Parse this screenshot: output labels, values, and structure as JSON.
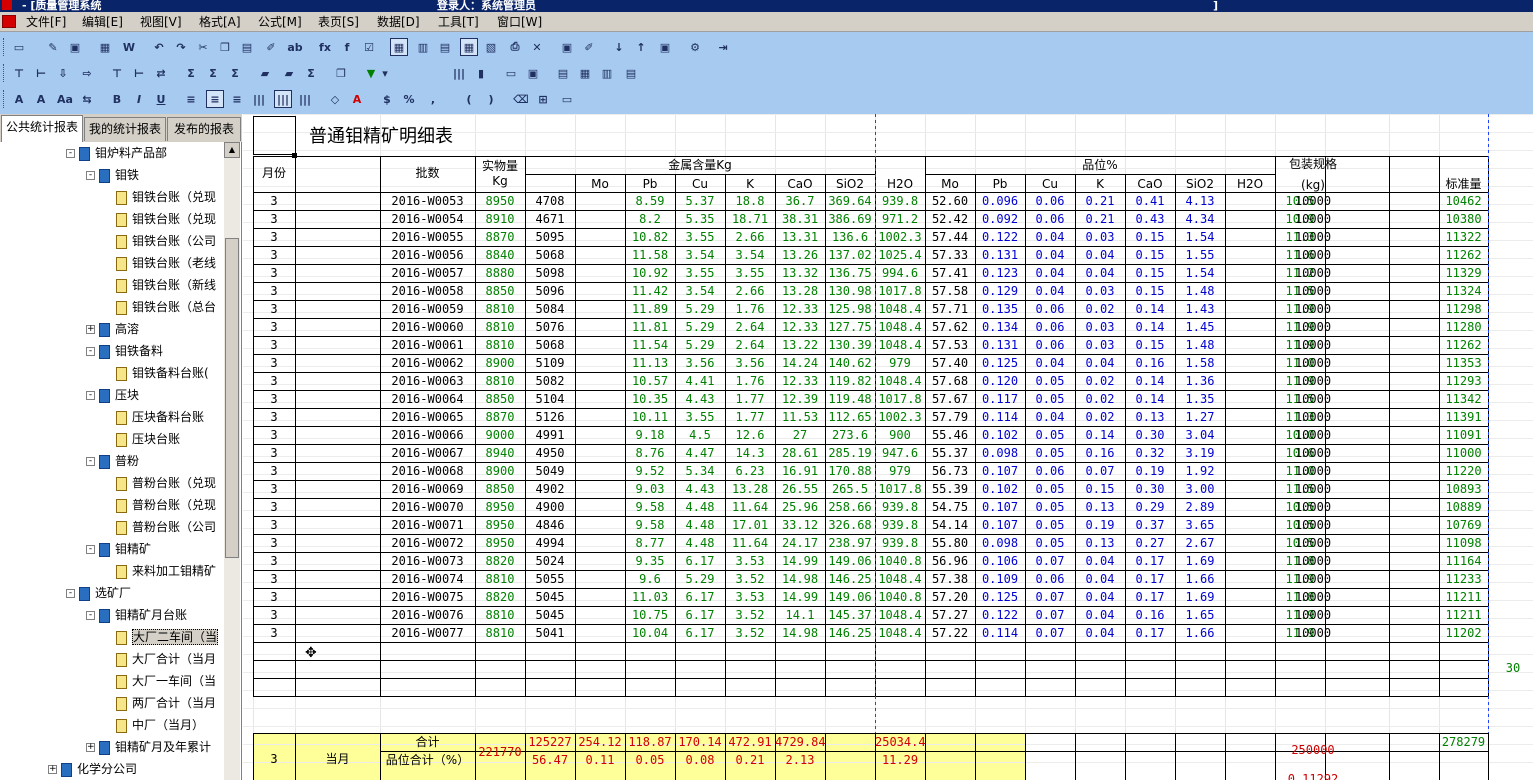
{
  "window": {
    "title_left": "- [质量管理系统",
    "title_mid": "登录人：系统管理员",
    "title_right": "]"
  },
  "menu": [
    "文件[F]",
    "编辑[E]",
    "视图[V]",
    "格式[A]",
    "公式[M]",
    "表页[S]",
    "数据[D]",
    "工具[T]",
    "窗口[W]"
  ],
  "tabs": [
    "公共统计报表",
    "我的统计报表",
    "发布的报表"
  ],
  "tree": [
    {
      "label": "钼炉料产品部",
      "level": 0,
      "icon": "book",
      "exp": "-"
    },
    {
      "label": "钼铁",
      "level": 1,
      "icon": "book",
      "exp": "-"
    },
    {
      "label": "钼铁台账（兑现",
      "level": 2,
      "icon": "doc"
    },
    {
      "label": "钼铁台账（兑现",
      "level": 2,
      "icon": "doc"
    },
    {
      "label": "钼铁台账（公司",
      "level": 2,
      "icon": "doc"
    },
    {
      "label": "钼铁台账（老线",
      "level": 2,
      "icon": "doc"
    },
    {
      "label": "钼铁台账（新线",
      "level": 2,
      "icon": "doc"
    },
    {
      "label": "钼铁台账（总台",
      "level": 2,
      "icon": "doc"
    },
    {
      "label": "高溶",
      "level": 1,
      "icon": "book",
      "exp": "+"
    },
    {
      "label": "钼铁备料",
      "level": 1,
      "icon": "book",
      "exp": "-"
    },
    {
      "label": "钼铁备料台账(",
      "level": 2,
      "icon": "doc"
    },
    {
      "label": "压块",
      "level": 1,
      "icon": "book",
      "exp": "-"
    },
    {
      "label": "压块备料台账",
      "level": 2,
      "icon": "doc"
    },
    {
      "label": "压块台账",
      "level": 2,
      "icon": "doc"
    },
    {
      "label": "普粉",
      "level": 1,
      "icon": "book",
      "exp": "-"
    },
    {
      "label": "普粉台账（兑现",
      "level": 2,
      "icon": "doc"
    },
    {
      "label": "普粉台账（兑现",
      "level": 2,
      "icon": "doc"
    },
    {
      "label": "普粉台账（公司",
      "level": 2,
      "icon": "doc"
    },
    {
      "label": "钼精矿",
      "level": 1,
      "icon": "book",
      "exp": "-"
    },
    {
      "label": "来料加工钼精矿",
      "level": 2,
      "icon": "doc"
    },
    {
      "label": "选矿厂",
      "level": 0,
      "icon": "book",
      "exp": "-"
    },
    {
      "label": "钼精矿月台账",
      "level": 1,
      "icon": "book",
      "exp": "-"
    },
    {
      "label": "大厂二车间（当",
      "level": 2,
      "icon": "edit",
      "selected": true
    },
    {
      "label": "大厂合计（当月",
      "level": 2,
      "icon": "doc"
    },
    {
      "label": "大厂一车间（当",
      "level": 2,
      "icon": "doc"
    },
    {
      "label": "两厂合计（当月",
      "level": 2,
      "icon": "doc"
    },
    {
      "label": "中厂（当月）",
      "level": 2,
      "icon": "doc"
    },
    {
      "label": "钼精矿月及年累计",
      "level": 1,
      "icon": "book",
      "exp": "+"
    },
    {
      "label": "化学分公司",
      "level": -1,
      "icon": "book",
      "exp": "+"
    }
  ],
  "report": {
    "title": "普通钼精矿明细表",
    "headers": {
      "month": "月份",
      "batch": "批数",
      "actual": "实物量",
      "actual_unit": "Kg",
      "metal": "金属含量Kg",
      "grade": "品位%",
      "package": "包装规格",
      "package_unit": "(kg)",
      "std": "标准量",
      "metal_cols": [
        "Mo",
        "Pb",
        "Cu",
        "K",
        "CaO",
        "SiO2",
        "H2O"
      ],
      "grade_cols": [
        "Mo",
        "Pb",
        "Cu",
        "K",
        "CaO",
        "SiO2",
        "H2O"
      ]
    },
    "rows": [
      [
        "3",
        "2016-W0053",
        "8950",
        "4708",
        "8.59",
        "5.37",
        "18.8",
        "36.7",
        "369.64",
        "939.8",
        "52.60",
        "0.096",
        "0.06",
        "0.21",
        "0.41",
        "4.13",
        "10.5",
        "10000",
        "10462"
      ],
      [
        "3",
        "2016-W0054",
        "8910",
        "4671",
        "8.2",
        "5.35",
        "18.71",
        "38.31",
        "386.69",
        "971.2",
        "52.42",
        "0.092",
        "0.06",
        "0.21",
        "0.43",
        "4.34",
        "10.9",
        "10000",
        "10380"
      ],
      [
        "3",
        "2016-W0055",
        "8870",
        "5095",
        "10.82",
        "3.55",
        "2.66",
        "13.31",
        "136.6",
        "1002.3",
        "57.44",
        "0.122",
        "0.04",
        "0.03",
        "0.15",
        "1.54",
        "11.3",
        "10000",
        "11322"
      ],
      [
        "3",
        "2016-W0056",
        "8840",
        "5068",
        "11.58",
        "3.54",
        "3.54",
        "13.26",
        "137.02",
        "1025.4",
        "57.33",
        "0.131",
        "0.04",
        "0.04",
        "0.15",
        "1.55",
        "11.6",
        "10000",
        "11262"
      ],
      [
        "3",
        "2016-W0057",
        "8880",
        "5098",
        "10.92",
        "3.55",
        "3.55",
        "13.32",
        "136.75",
        "994.6",
        "57.41",
        "0.123",
        "0.04",
        "0.04",
        "0.15",
        "1.54",
        "11.2",
        "10000",
        "11329"
      ],
      [
        "3",
        "2016-W0058",
        "8850",
        "5096",
        "11.42",
        "3.54",
        "2.66",
        "13.28",
        "130.98",
        "1017.8",
        "57.58",
        "0.129",
        "0.04",
        "0.03",
        "0.15",
        "1.48",
        "11.5",
        "10000",
        "11324"
      ],
      [
        "3",
        "2016-W0059",
        "8810",
        "5084",
        "11.89",
        "5.29",
        "1.76",
        "12.33",
        "125.98",
        "1048.4",
        "57.71",
        "0.135",
        "0.06",
        "0.02",
        "0.14",
        "1.43",
        "11.9",
        "10000",
        "11298"
      ],
      [
        "3",
        "2016-W0060",
        "8810",
        "5076",
        "11.81",
        "5.29",
        "2.64",
        "12.33",
        "127.75",
        "1048.4",
        "57.62",
        "0.134",
        "0.06",
        "0.03",
        "0.14",
        "1.45",
        "11.9",
        "10000",
        "11280"
      ],
      [
        "3",
        "2016-W0061",
        "8810",
        "5068",
        "11.54",
        "5.29",
        "2.64",
        "13.22",
        "130.39",
        "1048.4",
        "57.53",
        "0.131",
        "0.06",
        "0.03",
        "0.15",
        "1.48",
        "11.9",
        "10000",
        "11262"
      ],
      [
        "3",
        "2016-W0062",
        "8900",
        "5109",
        "11.13",
        "3.56",
        "3.56",
        "14.24",
        "140.62",
        "979",
        "57.40",
        "0.125",
        "0.04",
        "0.04",
        "0.16",
        "1.58",
        "11.0",
        "10000",
        "11353"
      ],
      [
        "3",
        "2016-W0063",
        "8810",
        "5082",
        "10.57",
        "4.41",
        "1.76",
        "12.33",
        "119.82",
        "1048.4",
        "57.68",
        "0.120",
        "0.05",
        "0.02",
        "0.14",
        "1.36",
        "11.9",
        "10000",
        "11293"
      ],
      [
        "3",
        "2016-W0064",
        "8850",
        "5104",
        "10.35",
        "4.43",
        "1.77",
        "12.39",
        "119.48",
        "1017.8",
        "57.67",
        "0.117",
        "0.05",
        "0.02",
        "0.14",
        "1.35",
        "11.5",
        "10000",
        "11342"
      ],
      [
        "3",
        "2016-W0065",
        "8870",
        "5126",
        "10.11",
        "3.55",
        "1.77",
        "11.53",
        "112.65",
        "1002.3",
        "57.79",
        "0.114",
        "0.04",
        "0.02",
        "0.13",
        "1.27",
        "11.3",
        "10000",
        "11391"
      ],
      [
        "3",
        "2016-W0066",
        "9000",
        "4991",
        "9.18",
        "4.5",
        "12.6",
        "27",
        "273.6",
        "900",
        "55.46",
        "0.102",
        "0.05",
        "0.14",
        "0.30",
        "3.04",
        "10.0",
        "10000",
        "11091"
      ],
      [
        "3",
        "2016-W0067",
        "8940",
        "4950",
        "8.76",
        "4.47",
        "14.3",
        "28.61",
        "285.19",
        "947.6",
        "55.37",
        "0.098",
        "0.05",
        "0.16",
        "0.32",
        "3.19",
        "10.6",
        "10000",
        "11000"
      ],
      [
        "3",
        "2016-W0068",
        "8900",
        "5049",
        "9.52",
        "5.34",
        "6.23",
        "16.91",
        "170.88",
        "979",
        "56.73",
        "0.107",
        "0.06",
        "0.07",
        "0.19",
        "1.92",
        "11.0",
        "10000",
        "11220"
      ],
      [
        "3",
        "2016-W0069",
        "8850",
        "4902",
        "9.03",
        "4.43",
        "13.28",
        "26.55",
        "265.5",
        "1017.8",
        "55.39",
        "0.102",
        "0.05",
        "0.15",
        "0.30",
        "3.00",
        "11.5",
        "10000",
        "10893"
      ],
      [
        "3",
        "2016-W0070",
        "8950",
        "4900",
        "9.58",
        "4.48",
        "11.64",
        "25.96",
        "258.66",
        "939.8",
        "54.75",
        "0.107",
        "0.05",
        "0.13",
        "0.29",
        "2.89",
        "10.5",
        "10000",
        "10889"
      ],
      [
        "3",
        "2016-W0071",
        "8950",
        "4846",
        "9.58",
        "4.48",
        "17.01",
        "33.12",
        "326.68",
        "939.8",
        "54.14",
        "0.107",
        "0.05",
        "0.19",
        "0.37",
        "3.65",
        "10.5",
        "10000",
        "10769"
      ],
      [
        "3",
        "2016-W0072",
        "8950",
        "4994",
        "8.77",
        "4.48",
        "11.64",
        "24.17",
        "238.97",
        "939.8",
        "55.80",
        "0.098",
        "0.05",
        "0.13",
        "0.27",
        "2.67",
        "10.5",
        "10000",
        "11098"
      ],
      [
        "3",
        "2016-W0073",
        "8820",
        "5024",
        "9.35",
        "6.17",
        "3.53",
        "14.99",
        "149.06",
        "1040.8",
        "56.96",
        "0.106",
        "0.07",
        "0.04",
        "0.17",
        "1.69",
        "11.8",
        "10000",
        "11164"
      ],
      [
        "3",
        "2016-W0074",
        "8810",
        "5055",
        "9.6",
        "5.29",
        "3.52",
        "14.98",
        "146.25",
        "1048.4",
        "57.38",
        "0.109",
        "0.06",
        "0.04",
        "0.17",
        "1.66",
        "11.9",
        "10000",
        "11233"
      ],
      [
        "3",
        "2016-W0075",
        "8820",
        "5045",
        "11.03",
        "6.17",
        "3.53",
        "14.99",
        "149.06",
        "1040.8",
        "57.20",
        "0.125",
        "0.07",
        "0.04",
        "0.17",
        "1.69",
        "11.8",
        "10000",
        "11211"
      ],
      [
        "3",
        "2016-W0076",
        "8810",
        "5045",
        "10.75",
        "6.17",
        "3.52",
        "14.1",
        "145.37",
        "1048.4",
        "57.27",
        "0.122",
        "0.07",
        "0.04",
        "0.16",
        "1.65",
        "11.9",
        "10000",
        "11211"
      ],
      [
        "3",
        "2016-W0077",
        "8810",
        "5041",
        "10.04",
        "6.17",
        "3.52",
        "14.98",
        "146.25",
        "1048.4",
        "57.22",
        "0.114",
        "0.07",
        "0.04",
        "0.17",
        "1.66",
        "11.9",
        "10000",
        "11202"
      ]
    ],
    "side_value": "30",
    "summary": {
      "month": "3",
      "period": "当月",
      "total_label": "合计",
      "grade_label": "品位合计（%）",
      "actual_total": "221770",
      "metal_totals": [
        "125227",
        "254.12",
        "118.87",
        "170.14",
        "472.91",
        "4729.84"
      ],
      "metal_grades": [
        "56.47",
        "0.11",
        "0.05",
        "0.08",
        "0.21",
        "2.13"
      ],
      "h2o_total": "25034.4",
      "h2o_grade": "11.29",
      "package_total": "250000",
      "package_extra": "0.11292",
      "std_total": "278279"
    }
  }
}
